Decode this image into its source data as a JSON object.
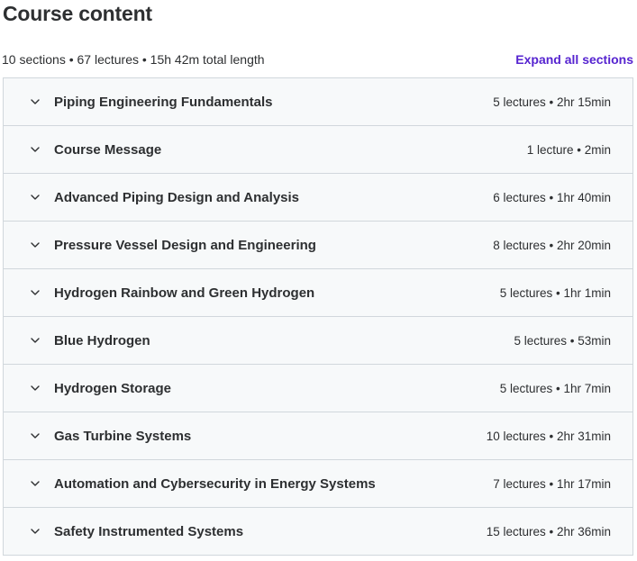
{
  "header": {
    "title": "Course content",
    "summary": "10 sections • 67 lectures • 15h 42m total length",
    "expand_all_label": "Expand all sections"
  },
  "sections": [
    {
      "title": "Piping Engineering Fundamentals",
      "info": "5 lectures • 2hr 15min"
    },
    {
      "title": "Course Message",
      "info": "1 lecture • 2min"
    },
    {
      "title": "Advanced Piping Design and Analysis",
      "info": "6 lectures • 1hr 40min"
    },
    {
      "title": "Pressure Vessel Design and Engineering",
      "info": "8 lectures • 2hr 20min"
    },
    {
      "title": "Hydrogen Rainbow and Green Hydrogen",
      "info": "5 lectures • 1hr 1min"
    },
    {
      "title": "Blue Hydrogen",
      "info": "5 lectures • 53min"
    },
    {
      "title": "Hydrogen Storage",
      "info": "5 lectures • 1hr 7min"
    },
    {
      "title": "Gas Turbine Systems",
      "info": "10 lectures • 2hr 31min"
    },
    {
      "title": "Automation and Cybersecurity in Energy Systems",
      "info": "7 lectures • 1hr 17min"
    },
    {
      "title": "Safety Instrumented Systems",
      "info": "15 lectures • 2hr 36min"
    }
  ],
  "colors": {
    "accent": "#5624d0",
    "text": "#2d2f31",
    "row_bg": "#f7f9fa",
    "border": "#d1d7dc"
  },
  "icons": {
    "section_toggle": "chevron-down-icon"
  }
}
